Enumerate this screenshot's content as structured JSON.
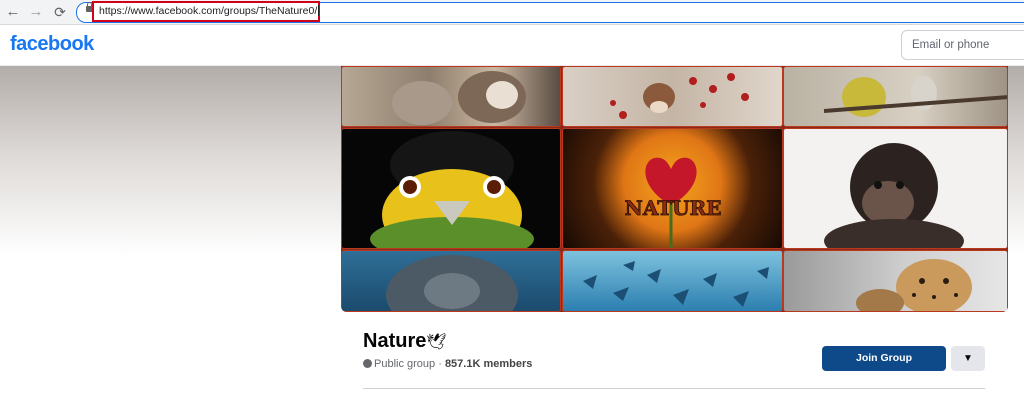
{
  "browser": {
    "url": "https://www.facebook.com/groups/TheNature0/",
    "back_icon": "←",
    "forward_icon": "→",
    "reload_icon": "⟳"
  },
  "header": {
    "logo": "facebook",
    "email_placeholder": "Email or phone"
  },
  "group": {
    "name": "Nature",
    "emoji": "🕊",
    "privacy": "Public group",
    "separator": " · ",
    "members": "857.1K members",
    "join_label": "Join Group",
    "more_icon": "▼"
  },
  "cover": {
    "tile_text": "NATURE"
  },
  "colors": {
    "brand": "#1877f2",
    "join_button": "#0e4a8a",
    "annotation": "#d0021b"
  }
}
